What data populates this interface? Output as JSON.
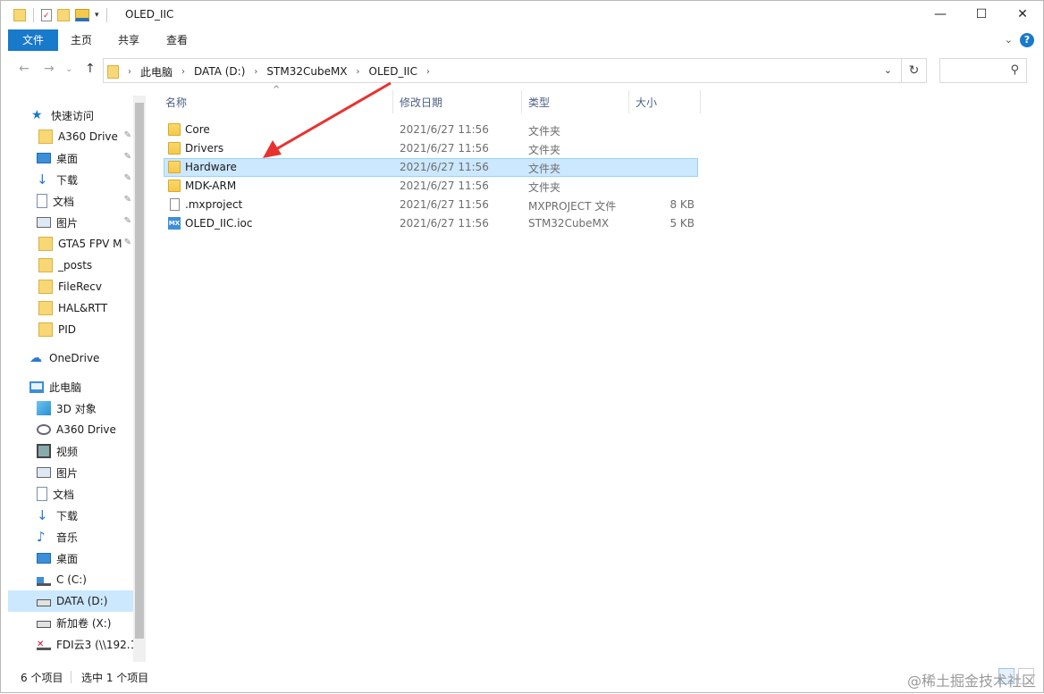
{
  "window": {
    "title": "OLED_IIC",
    "controls": {
      "minimize": "—",
      "maximize": "☐",
      "close": "✕"
    }
  },
  "ribbon": {
    "tabs": [
      "文件",
      "主页",
      "共享",
      "查看"
    ],
    "help": "?"
  },
  "nav": {
    "back": "←",
    "forward": "→",
    "up": "↑",
    "breadcrumbs": [
      "此电脑",
      "DATA (D:)",
      "STM32CubeMX",
      "OLED_IIC"
    ],
    "refresh": "↻",
    "search_placeholder": ""
  },
  "sidebar": {
    "quick_access": "快速访问",
    "quick_items": [
      "A360 Drive",
      "桌面",
      "下载",
      "文档",
      "图片",
      "GTA5 FPV M",
      "_posts",
      "FileRecv",
      "HAL&RTT",
      "PID"
    ],
    "onedrive": "OneDrive",
    "this_pc": "此电脑",
    "pc_items": [
      "3D 对象",
      "A360 Drive",
      "视频",
      "图片",
      "文档",
      "下载",
      "音乐",
      "桌面",
      "C (C:)",
      "DATA (D:)",
      "新加卷 (X:)",
      "FDI云3 (\\\\192.1"
    ]
  },
  "columns": {
    "name": "名称",
    "date": "修改日期",
    "type": "类型",
    "size": "大小"
  },
  "files": [
    {
      "name": "Core",
      "date": "2021/6/27 11:56",
      "type": "文件夹",
      "size": "",
      "icon": "folder-icon"
    },
    {
      "name": "Drivers",
      "date": "2021/6/27 11:56",
      "type": "文件夹",
      "size": "",
      "icon": "folder-icon"
    },
    {
      "name": "Hardware",
      "date": "2021/6/27 11:56",
      "type": "文件夹",
      "size": "",
      "icon": "folder-icon"
    },
    {
      "name": "MDK-ARM",
      "date": "2021/6/27 11:56",
      "type": "文件夹",
      "size": "",
      "icon": "folder-icon"
    },
    {
      "name": ".mxproject",
      "date": "2021/6/27 11:56",
      "type": "MXPROJECT 文件",
      "size": "8 KB",
      "icon": "file-icon"
    },
    {
      "name": "OLED_IIC.ioc",
      "date": "2021/6/27 11:56",
      "type": "STM32CubeMX",
      "size": "5 KB",
      "icon": "stm32cubemx-icon"
    }
  ],
  "selected_file": "Hardware",
  "status": {
    "count": "6 个项目",
    "selection": "选中 1 个项目"
  },
  "watermark": "@稀土掘金技术社区",
  "colors": {
    "accent": "#1979ca",
    "selection": "#cce8ff",
    "annotation_arrow": "#e8322f"
  }
}
